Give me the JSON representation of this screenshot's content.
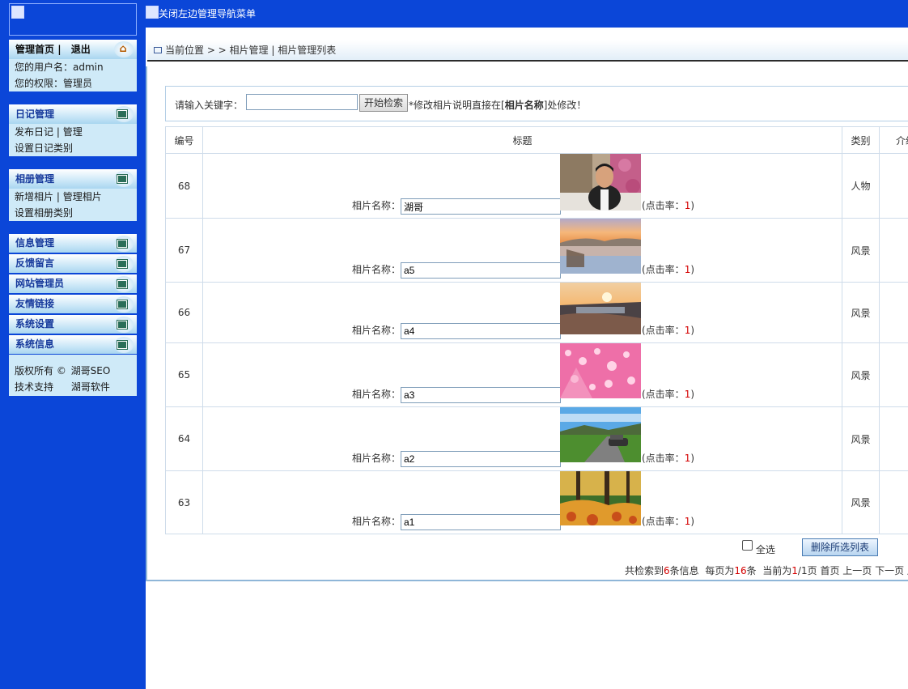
{
  "sidebar": {
    "home": {
      "home_label": "管理首页",
      "separator": "|",
      "logout_label": "退出"
    },
    "user": {
      "name_label": "您的用户名：admin",
      "role_label": "您的权限：管理员"
    },
    "diary": {
      "title": "日记管理",
      "publish": "发布日记",
      "sep": "|",
      "manage": "管理",
      "categories": "设置日记类别"
    },
    "album": {
      "title": "相册管理",
      "add": "新增相片",
      "sep": "|",
      "manage": "管理相片",
      "categories": "设置相册类别"
    },
    "sections": [
      "信息管理",
      "反馈留言",
      "网站管理员",
      "友情链接",
      "系统设置",
      "系统信息"
    ],
    "copyright_label": "版权所有 ©",
    "copyright_value": "湖哥SEO",
    "support_label": "技术支持",
    "support_value": "湖哥软件"
  },
  "topbar": {
    "toggle_label": "关闭左边管理导航菜单"
  },
  "breadcrumb": "当前位置 > > 相片管理 | 相片管理列表",
  "search": {
    "label": "请输入关键字：",
    "value": "",
    "button": "开始检索",
    "tip_prefix": "*修改相片说明直接在[",
    "tip_bold": "相片名称",
    "tip_suffix": "]处修改！"
  },
  "table": {
    "headers": [
      "编号",
      "标题",
      "类别",
      "介绍"
    ],
    "name_label": "相片名称：",
    "clicks_prefix": "(点击率：",
    "clicks_suffix": ")",
    "rows": [
      {
        "id": "68",
        "name": "湖哥",
        "category": "人物",
        "clicks": "1",
        "image": "portrait"
      },
      {
        "id": "67",
        "name": "a5",
        "category": "风景",
        "clicks": "1",
        "image": "lake-sunset"
      },
      {
        "id": "66",
        "name": "a4",
        "category": "风景",
        "clicks": "1",
        "image": "beach-sunset"
      },
      {
        "id": "65",
        "name": "a3",
        "category": "风景",
        "clicks": "1",
        "image": "pink-coral"
      },
      {
        "id": "64",
        "name": "a2",
        "category": "风景",
        "clicks": "1",
        "image": "road-car"
      },
      {
        "id": "63",
        "name": "a1",
        "category": "风景",
        "clicks": "1",
        "image": "autumn-forest"
      }
    ]
  },
  "footer": {
    "select_all": "全选",
    "delete_button": "删除所选列表"
  },
  "pager": {
    "total_prefix": "共检索到",
    "total": "6",
    "total_suffix": "条信息",
    "per_page_prefix": "每页为",
    "per_page": "16",
    "per_page_suffix": "条",
    "current_prefix": "当前为",
    "current": "1",
    "current_sep": "/1页",
    "first": "首页",
    "prev": "上一页",
    "next": "下一页",
    "last": "尾页"
  },
  "colors": {
    "sidebar_bg": "#0b46d8",
    "panel_bg": "#cfeaf8",
    "accent_red": "#d40000"
  }
}
